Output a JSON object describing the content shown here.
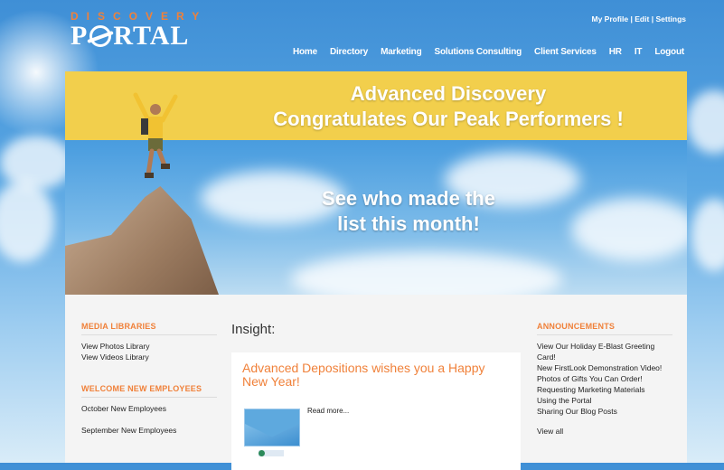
{
  "header": {
    "logo_top": "DISCOVERY",
    "logo_left": "P",
    "logo_right": "RTAL",
    "util_links": [
      "My Profile",
      "Edit",
      "Settings"
    ],
    "util_sep": "|",
    "nav": [
      "Home",
      "Directory",
      "Marketing",
      "Solutions Consulting",
      "Client Services",
      "HR",
      "IT",
      "Logout"
    ]
  },
  "banner": {
    "line1": "Advanced Discovery",
    "line2": "Congratulates Our Peak Performers !",
    "see1": "See who made the",
    "see2": "list this month!"
  },
  "media": {
    "title": "MEDIA LIBRARIES",
    "items": [
      "View Photos Library",
      "View Videos Library"
    ]
  },
  "welcome": {
    "title": "WELCOME NEW EMPLOYEES",
    "items": [
      "October New Employees",
      "September New Employees"
    ]
  },
  "insight": {
    "title": "Insight:",
    "headline": "Advanced Depositions wishes you a Happy New Year!",
    "read_more": "Read more..."
  },
  "announcements": {
    "title": "ANNOUNCEMENTS",
    "items": [
      "View Our Holiday E-Blast Greeting Card!",
      "New FirstLook Demonstration Video!",
      "Photos of Gifts You Can Order!",
      "Requesting Marketing Materials",
      "Using the Portal",
      "Sharing Our Blog Posts"
    ],
    "view_all": "View all"
  },
  "colors": {
    "accent": "#f0813a",
    "banner_strip": "#f2cf4c",
    "sky": "#3f8fd6"
  }
}
